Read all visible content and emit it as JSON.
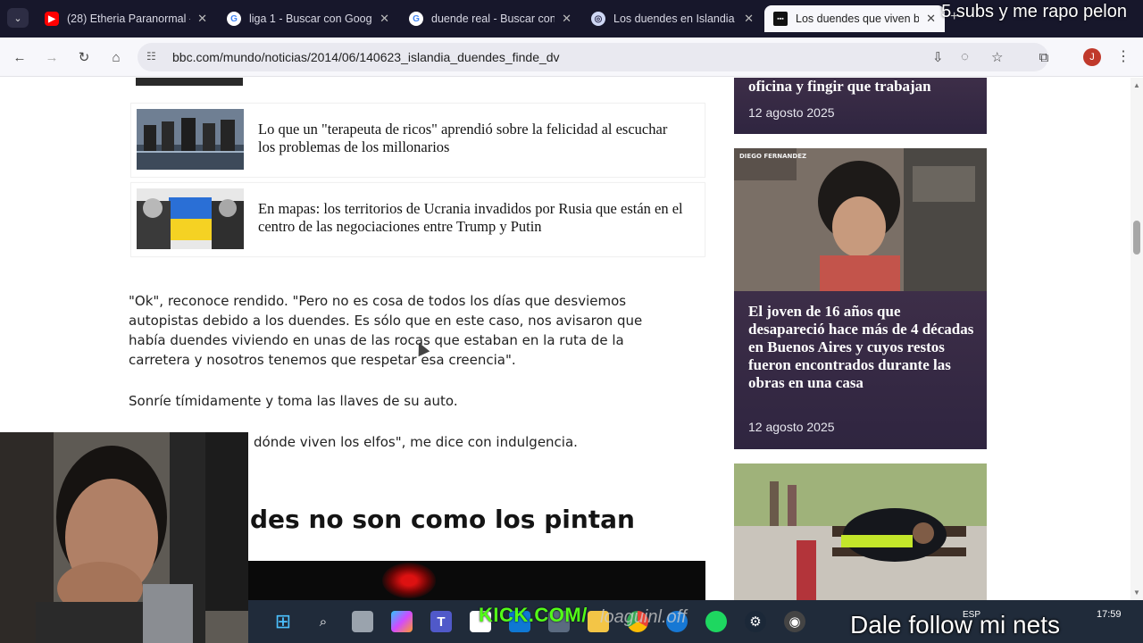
{
  "tabs": [
    {
      "title": "(28) Etheria Paranormal -",
      "favicon": "youtube-icon",
      "color": "#ff0000"
    },
    {
      "title": "liga 1 - Buscar con Googl",
      "favicon": "google-icon",
      "color": "#4285f4"
    },
    {
      "title": "duende real - Buscar con",
      "favicon": "google-icon",
      "color": "#4285f4"
    },
    {
      "title": "Los duendes en Islandia",
      "favicon": "web-icon",
      "color": "#8ab4f8"
    },
    {
      "title": "Los duendes que viven b",
      "favicon": "bbc-icon",
      "color": "#ffffff"
    }
  ],
  "close_glyph": "✕",
  "stream_overlay_top": "5 subs y me rapo pelon",
  "address_bar": {
    "url": "bbc.com/mundo/noticias/2014/06/140623_islandia_duendes_finde_dv"
  },
  "profile_initial": "J",
  "related": [
    {
      "title": "Lo que un \"terapeuta de ricos\" aprendió sobre la felicidad al escuchar los problemas de los millonarios"
    },
    {
      "title": "En mapas: los territorios de Ucrania invadidos por Rusia que están en el centro de las negociaciones entre Trump y Putin"
    }
  ],
  "article": {
    "para1": "\"Ok\", reconoce rendido. \"Pero no es cosa de todos los días que desviemos autopistas debido a los duendes. Es sólo que en este caso, nos avisaron que había duendes viviendo en unas de las rocas que estaban en la ruta de la carretera y nosotros tenemos que respetar esa creencia\".",
    "para2": "Sonríe tímidamente y toma las llaves de su auto.",
    "para3": "dónde viven los elfos\", me dice con indulgencia.",
    "heading": "des no son como los pintan"
  },
  "sidebar": [
    {
      "title": "oficina y fingir que trabajan",
      "date": "12 agosto 2025"
    },
    {
      "title": "El joven de 16 años que desapareció hace más de 4 décadas en Buenos Aires y cuyos restos fueron encontrados durante las obras en una casa",
      "date": "12 agosto 2025",
      "image_caption": "DIEGO FERNANDEZ"
    }
  ],
  "taskbar": {
    "kick": "KICK.COM/",
    "kick_user": "loaguinl.off",
    "language": "ESP",
    "time": "17:59",
    "overlay_bottom": "Dale follow mi nets"
  }
}
